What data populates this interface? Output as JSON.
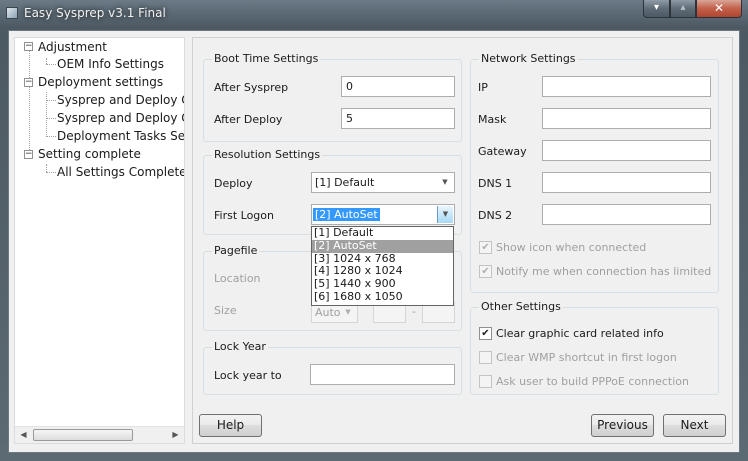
{
  "window": {
    "title": "Easy Sysprep v3.1 Final",
    "controls": {
      "minimize": "▾",
      "maximize": "▴",
      "close": "✕"
    }
  },
  "tree": {
    "items": [
      {
        "label": "Adjustment",
        "expander": "−"
      },
      {
        "label": "OEM Info Settings"
      },
      {
        "label": "Deployment settings",
        "expander": "−"
      },
      {
        "label": "Sysprep and Deploy Opt"
      },
      {
        "label": "Sysprep and Deploy Opt"
      },
      {
        "label": "Deployment Tasks Setti"
      },
      {
        "label": "Setting complete",
        "expander": "−"
      },
      {
        "label": "All Settings Complete"
      }
    ],
    "scroll_left": "◀",
    "scroll_right": "▶"
  },
  "boot_time": {
    "title": "Boot Time Settings",
    "after_sysprep_label": "After Sysprep",
    "after_sysprep_value": "0",
    "after_deploy_label": "After Deploy",
    "after_deploy_value": "5"
  },
  "resolution": {
    "title": "Resolution Settings",
    "deploy_label": "Deploy",
    "deploy_value": "[1] Default",
    "first_logon_label": "First Logon",
    "first_logon_value": "[2] AutoSet",
    "options": [
      "[1] Default",
      "[2] AutoSet",
      "[3] 1024 x 768",
      "[4] 1280 x 1024",
      "[5] 1440 x 900",
      "[6] 1680 x 1050"
    ],
    "selected_index": 1
  },
  "pagefile": {
    "title": "Pagefile",
    "location_label": "Location",
    "size_label": "Size",
    "size_value": "Auto",
    "range_separator": "-"
  },
  "lock_year": {
    "title": "Lock Year",
    "lock_year_to_label": "Lock year to",
    "lock_year_to_value": ""
  },
  "network": {
    "title": "Network Settings",
    "ip_label": "IP",
    "mask_label": "Mask",
    "gateway_label": "Gateway",
    "dns1_label": "DNS 1",
    "dns2_label": "DNS 2",
    "show_icon_label": "Show icon when connected",
    "show_icon_checked": true,
    "notify_label": "Notify me when connection has limited",
    "notify_checked": true
  },
  "other": {
    "title": "Other Settings",
    "clear_graphic_label": "Clear graphic card related info",
    "clear_graphic_checked": true,
    "clear_wmp_label": "Clear WMP shortcut in first logon",
    "clear_wmp_checked": false,
    "ask_pppoe_label": "Ask user to build PPPoE connection",
    "ask_pppoe_checked": false
  },
  "buttons": {
    "help": "Help",
    "previous": "Previous",
    "next": "Next"
  },
  "glyphs": {
    "check": "✔",
    "dropdown_arrow": "▼"
  }
}
